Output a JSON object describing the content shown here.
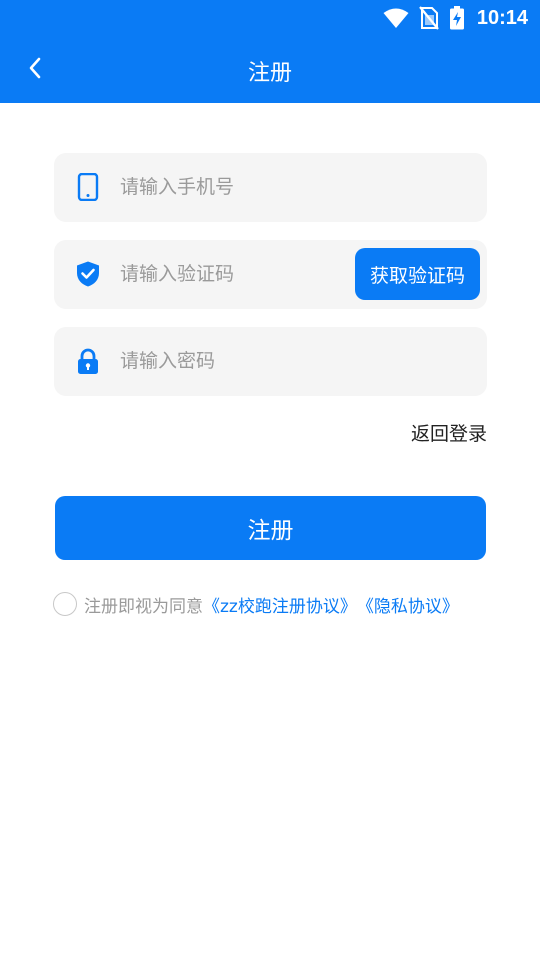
{
  "status_bar": {
    "time": "10:14",
    "icons": [
      "wifi-icon",
      "no-sim-icon",
      "battery-charging-icon"
    ]
  },
  "header": {
    "title": "注册",
    "back_icon": "chevron-left-icon"
  },
  "form": {
    "phone": {
      "icon": "tablet-icon",
      "placeholder": "请输入手机号",
      "value": ""
    },
    "code": {
      "icon": "shield-check-icon",
      "placeholder": "请输入验证码",
      "value": "",
      "button_label": "获取验证码"
    },
    "password": {
      "icon": "lock-icon",
      "placeholder": "请输入密码",
      "value": ""
    }
  },
  "back_to_login": "返回登录",
  "register_button": "注册",
  "agreement": {
    "checked": false,
    "prefix": "注册即视为同意",
    "terms_link": "《zz校跑注册协议》",
    "privacy_link": "《隐私协议》"
  },
  "colors": {
    "primary": "#0a7bf5",
    "field_bg": "#f5f5f5",
    "placeholder": "#9a9a9a"
  }
}
